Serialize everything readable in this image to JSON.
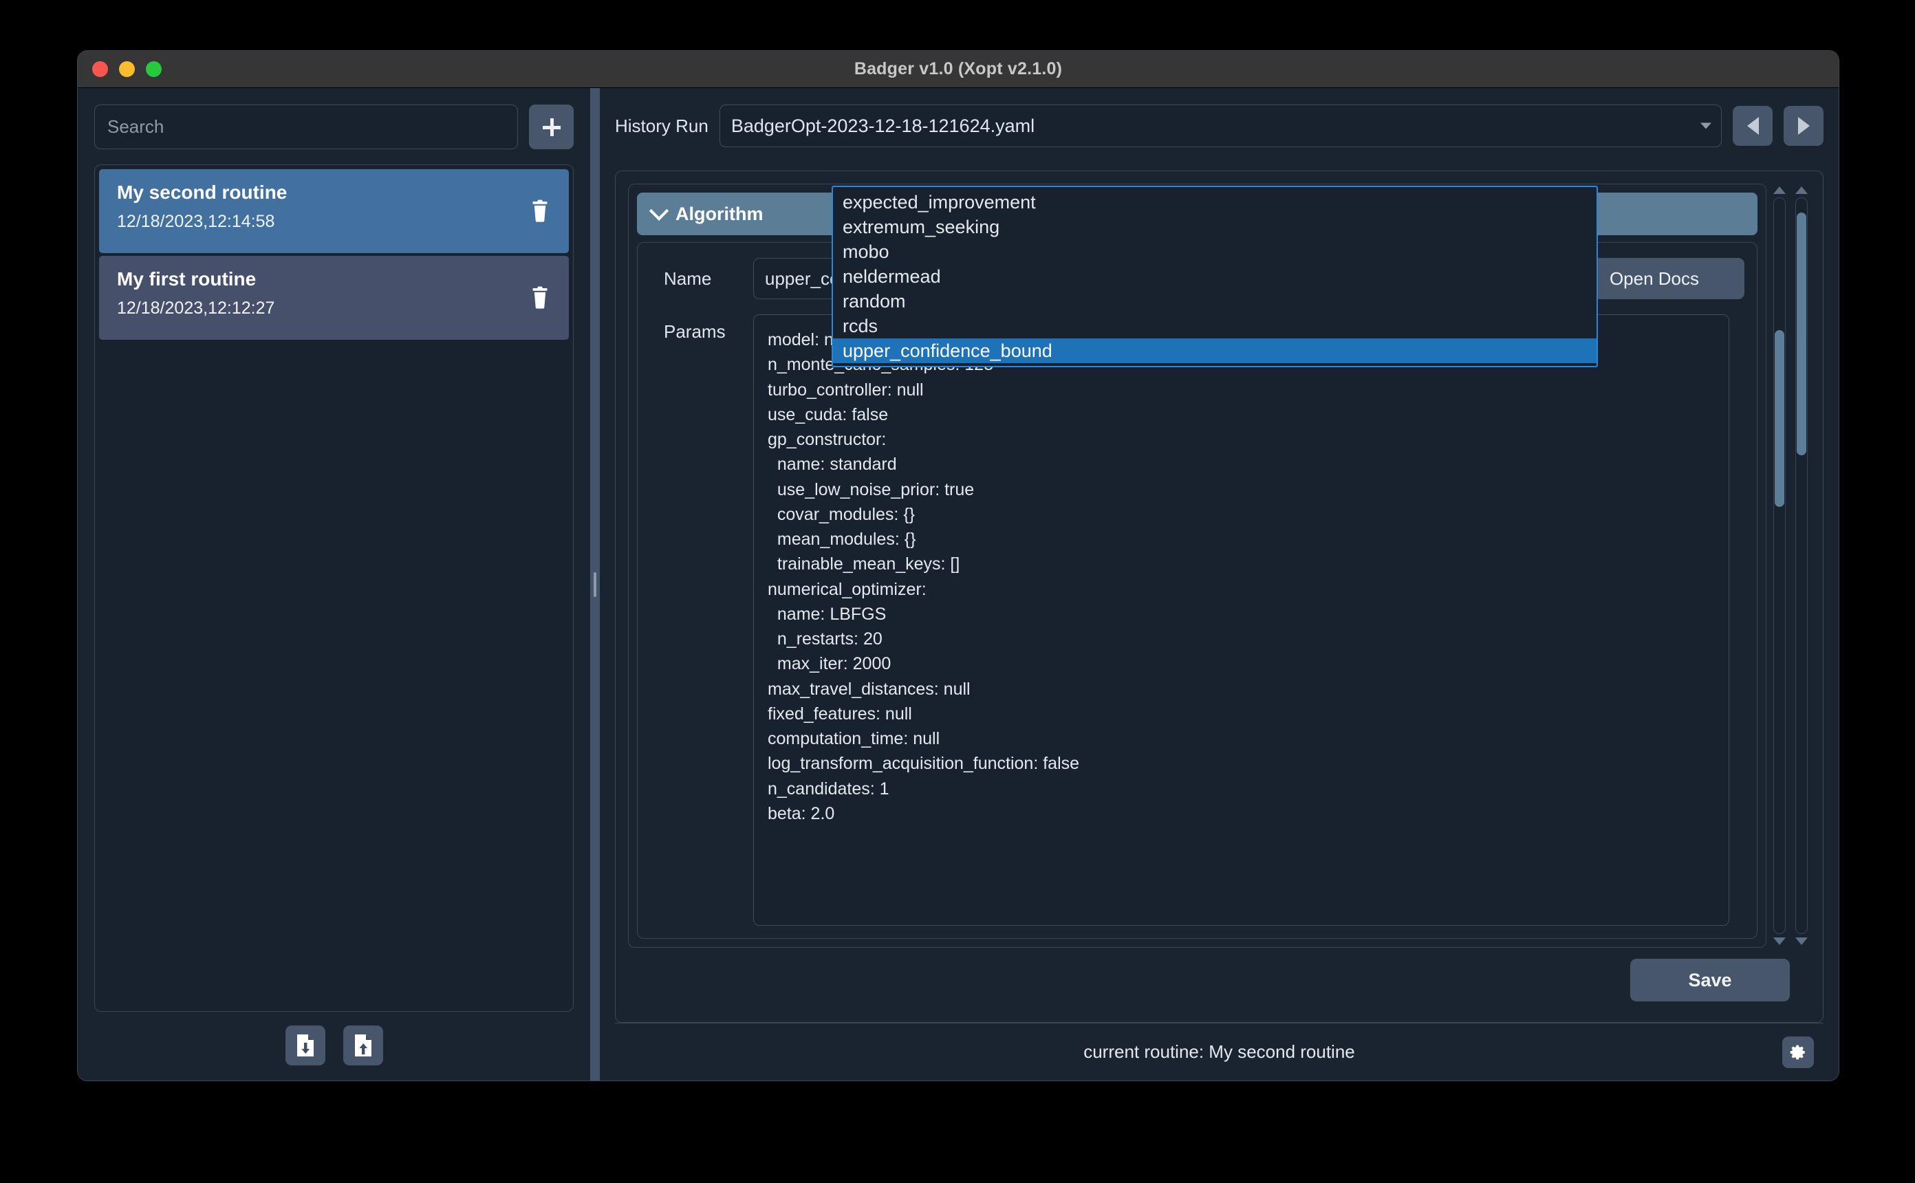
{
  "window": {
    "title": "Badger v1.0 (Xopt v2.1.0)"
  },
  "sidebar": {
    "search": {
      "placeholder": "Search",
      "value": ""
    },
    "add_button_label": "+",
    "routines": [
      {
        "name": "My second routine",
        "timestamp": "12/18/2023,12:14:58",
        "selected": true
      },
      {
        "name": "My first routine",
        "timestamp": "12/18/2023,12:12:27",
        "selected": false
      }
    ],
    "footer": {
      "import_icon": "file-download-icon",
      "export_icon": "file-upload-icon"
    }
  },
  "history": {
    "label": "History Run",
    "value": "BadgerOpt-2023-12-18-121624.yaml",
    "prev_icon": "triangle-left-icon",
    "next_icon": "triangle-right-icon"
  },
  "algorithm": {
    "section_title": "Algorithm",
    "name_label": "Name",
    "name_value": "upper_confidence_bound",
    "open_docs_label": "Open Docs",
    "params_label": "Params",
    "params_text": "model: null\nn_monte_carlo_samples: 128\nturbo_controller: null\nuse_cuda: false\ngp_constructor:\n  name: standard\n  use_low_noise_prior: true\n  covar_modules: {}\n  mean_modules: {}\n  trainable_mean_keys: []\nnumerical_optimizer:\n  name: LBFGS\n  n_restarts: 20\n  max_iter: 2000\nmax_travel_distances: null\nfixed_features: null\ncomputation_time: null\nlog_transform_acquisition_function: false\nn_candidates: 1\nbeta: 2.0"
  },
  "dropdown": {
    "open": true,
    "options": [
      "expected_improvement",
      "extremum_seeking",
      "mobo",
      "neldermead",
      "random",
      "rcds",
      "upper_confidence_bound"
    ],
    "highlighted": "upper_confidence_bound"
  },
  "actions": {
    "save_label": "Save"
  },
  "statusbar": {
    "text": "current routine: My second routine",
    "settings_icon": "gear-icon"
  },
  "colors": {
    "accent_selected": "#43719f",
    "dropdown_highlight": "#1e72b8",
    "dropdown_border": "#2f86d6",
    "section_header": "#5c7d96",
    "window_bg": "#1a2430",
    "button_bg": "#47566a"
  }
}
